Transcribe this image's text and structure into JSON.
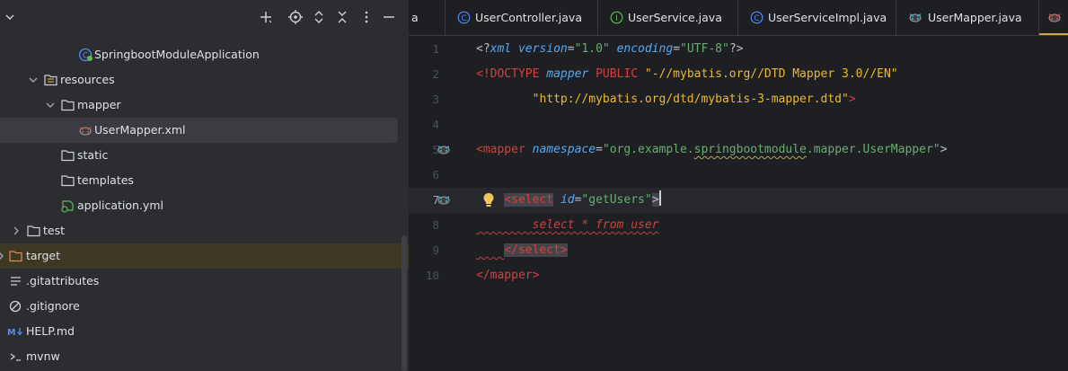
{
  "project": {
    "toolbar_icons": [
      "collapse-chevron-icon",
      "add-icon",
      "locate-icon",
      "expand-all-icon",
      "collapse-all-icon",
      "options-icon",
      "hide-icon"
    ],
    "tree": [
      {
        "label": "SpringbootModuleApplication",
        "icon": "spring-class-icon",
        "depth": 4
      },
      {
        "label": "resources",
        "icon": "resources-folder-icon",
        "depth": 2,
        "expanded": true
      },
      {
        "label": "mapper",
        "icon": "folder-icon",
        "depth": 3,
        "expanded": true
      },
      {
        "label": "UserMapper.xml",
        "icon": "mybatis-icon",
        "depth": 4,
        "selected": true
      },
      {
        "label": "static",
        "icon": "folder-icon",
        "depth": 3
      },
      {
        "label": "templates",
        "icon": "folder-icon",
        "depth": 3
      },
      {
        "label": "application.yml",
        "icon": "spring-yml-icon",
        "depth": 3
      },
      {
        "label": "test",
        "icon": "folder-icon",
        "depth": 1,
        "collapsed": true
      },
      {
        "label": "target",
        "icon": "excluded-folder-icon",
        "depth": 0,
        "collapsed": true
      },
      {
        "label": ".gitattributes",
        "icon": "text-file-icon",
        "depth": 0
      },
      {
        "label": ".gitignore",
        "icon": "ignore-file-icon",
        "depth": 0
      },
      {
        "label": "HELP.md",
        "icon": "markdown-icon",
        "depth": 0
      },
      {
        "label": "mvnw",
        "icon": "shell-file-icon",
        "depth": 0
      }
    ]
  },
  "editor": {
    "tabs": [
      {
        "label": "a",
        "icon": ""
      },
      {
        "label": "UserController.java",
        "icon": "class-icon"
      },
      {
        "label": "UserService.java",
        "icon": "interface-icon"
      },
      {
        "label": "UserServiceImpl.java",
        "icon": "class-icon"
      },
      {
        "label": "UserMapper.java",
        "icon": "mybatis-icon"
      },
      {
        "label": "",
        "icon": "mybatis-icon",
        "active": true
      }
    ],
    "line_numbers": [
      "1",
      "2",
      "3",
      "4",
      "5",
      "6",
      "7",
      "8",
      "9",
      "10"
    ],
    "current_line": "7",
    "code": {
      "l1_open": "<?",
      "l1_xml": "xml",
      "l1_version_attr": "version",
      "l1_version_val": "\"1.0\"",
      "l1_encoding_attr": "encoding",
      "l1_encoding_val": "\"UTF-8\"",
      "l1_close": "?>",
      "l2_doctype": "<!DOCTYPE",
      "l2_mapper": "mapper",
      "l2_public": "PUBLIC",
      "l2_str": "\"-//mybatis.org//DTD Mapper 3.0//EN\"",
      "l3_str": "\"http://mybatis.org/dtd/mybatis-3-mapper.dtd\"",
      "l3_close": ">",
      "l5_open": "<mapper",
      "l5_attr": "namespace",
      "l5_val_a": "\"org.example.",
      "l5_val_b": "springbootmodule",
      "l5_val_c": ".mapper.UserMapper\"",
      "l5_close": ">",
      "l7_open": "<select",
      "l7_attr": "id",
      "l7_val": "\"getUsers\"",
      "l7_close": ">",
      "l8_sql": "select * from user",
      "l9_close": "</select>",
      "l10_close": "</mapper>"
    }
  }
}
